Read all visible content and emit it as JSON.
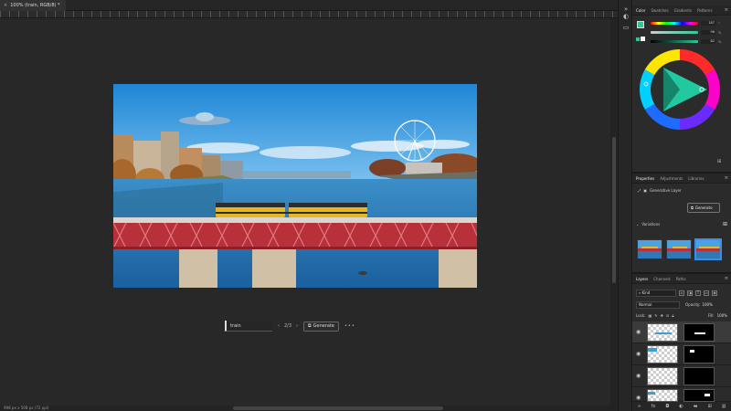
{
  "document": {
    "tab_label": "100% (train, RGB/8) *",
    "close": "×"
  },
  "status": {
    "dimensions": "998 px x 508 px (72 ppi)"
  },
  "contextual_bar": {
    "prompt": "train",
    "counter": "2/3",
    "generate_label": "Generate",
    "more": "•••",
    "prev": "‹",
    "next": "›"
  },
  "color_panel": {
    "tabs": [
      "Color",
      "Swatches",
      "Gradients",
      "Patterns"
    ],
    "sliders": [
      {
        "value": "187",
        "unit": "°"
      },
      {
        "value": "96",
        "unit": "%"
      },
      {
        "value": "82",
        "unit": "%"
      }
    ],
    "foreground": "#2ec79a",
    "background": "#ffffff"
  },
  "properties_panel": {
    "tabs": [
      "Properties",
      "Adjustments",
      "Libraries"
    ],
    "layer_type": "Generative Layer",
    "generate_label": "Generate",
    "variations_label": "Variations"
  },
  "layers_panel": {
    "tabs": [
      "Layers",
      "Channels",
      "Paths"
    ],
    "filter_label": "Kind",
    "blend_mode": "Normal",
    "opacity_label": "Opacity:",
    "opacity_value": "100%",
    "lock_label": "Lock:",
    "fill_label": "Fill:",
    "fill_value": "100%",
    "footer_icons": [
      "link-icon",
      "fx-icon",
      "mask-icon",
      "adjustment-icon",
      "folder-icon",
      "new-layer-icon",
      "trash-icon"
    ]
  },
  "accent_color": "#3a8ee8"
}
